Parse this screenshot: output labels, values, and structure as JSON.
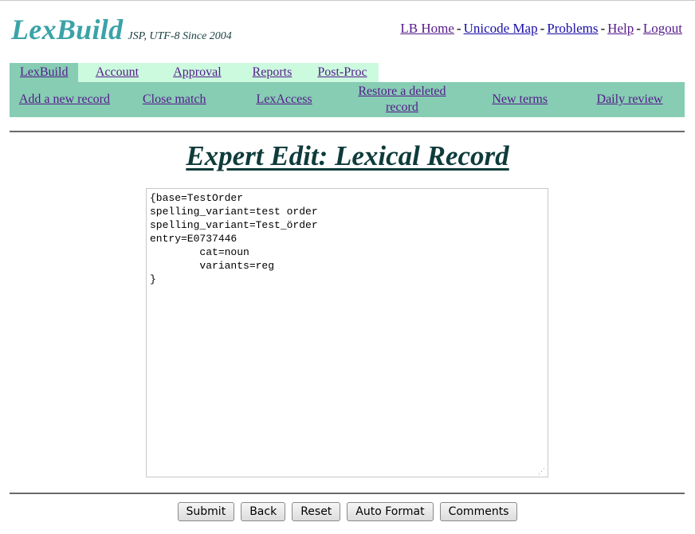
{
  "brand": {
    "name": "LexBuild",
    "tagline": "JSP, UTF-8 Since 2004",
    "color": "#3aa3a8"
  },
  "top_links": [
    {
      "label": "LB Home"
    },
    {
      "label": "Unicode Map"
    },
    {
      "label": "Problems"
    },
    {
      "label": "Help"
    },
    {
      "label": "Logout"
    }
  ],
  "tabs": [
    {
      "label": "LexBuild",
      "active": true
    },
    {
      "label": "Account"
    },
    {
      "label": "Approval"
    },
    {
      "label": "Reports"
    },
    {
      "label": "Post-Proc"
    }
  ],
  "subnav": [
    {
      "label": "Add a new record"
    },
    {
      "label": "Close match"
    },
    {
      "label": "LexAccess"
    },
    {
      "label": "Restore a deleted record"
    },
    {
      "label": "New terms"
    },
    {
      "label": "Daily review"
    }
  ],
  "page_title": "Expert Edit: Lexical Record",
  "record_text": "{base=TestOrder\nspelling_variant=test order\nspelling_variant=Test_örder\nentry=E0737446\n\tcat=noun\n\tvariants=reg\n}",
  "buttons": {
    "submit": "Submit",
    "back": "Back",
    "reset": "Reset",
    "auto_format": "Auto Format",
    "comments": "Comments"
  },
  "colors": {
    "tab_active": "#86cdb3",
    "tab_inactive": "#ccfadf",
    "heading": "#0f3b3b"
  }
}
